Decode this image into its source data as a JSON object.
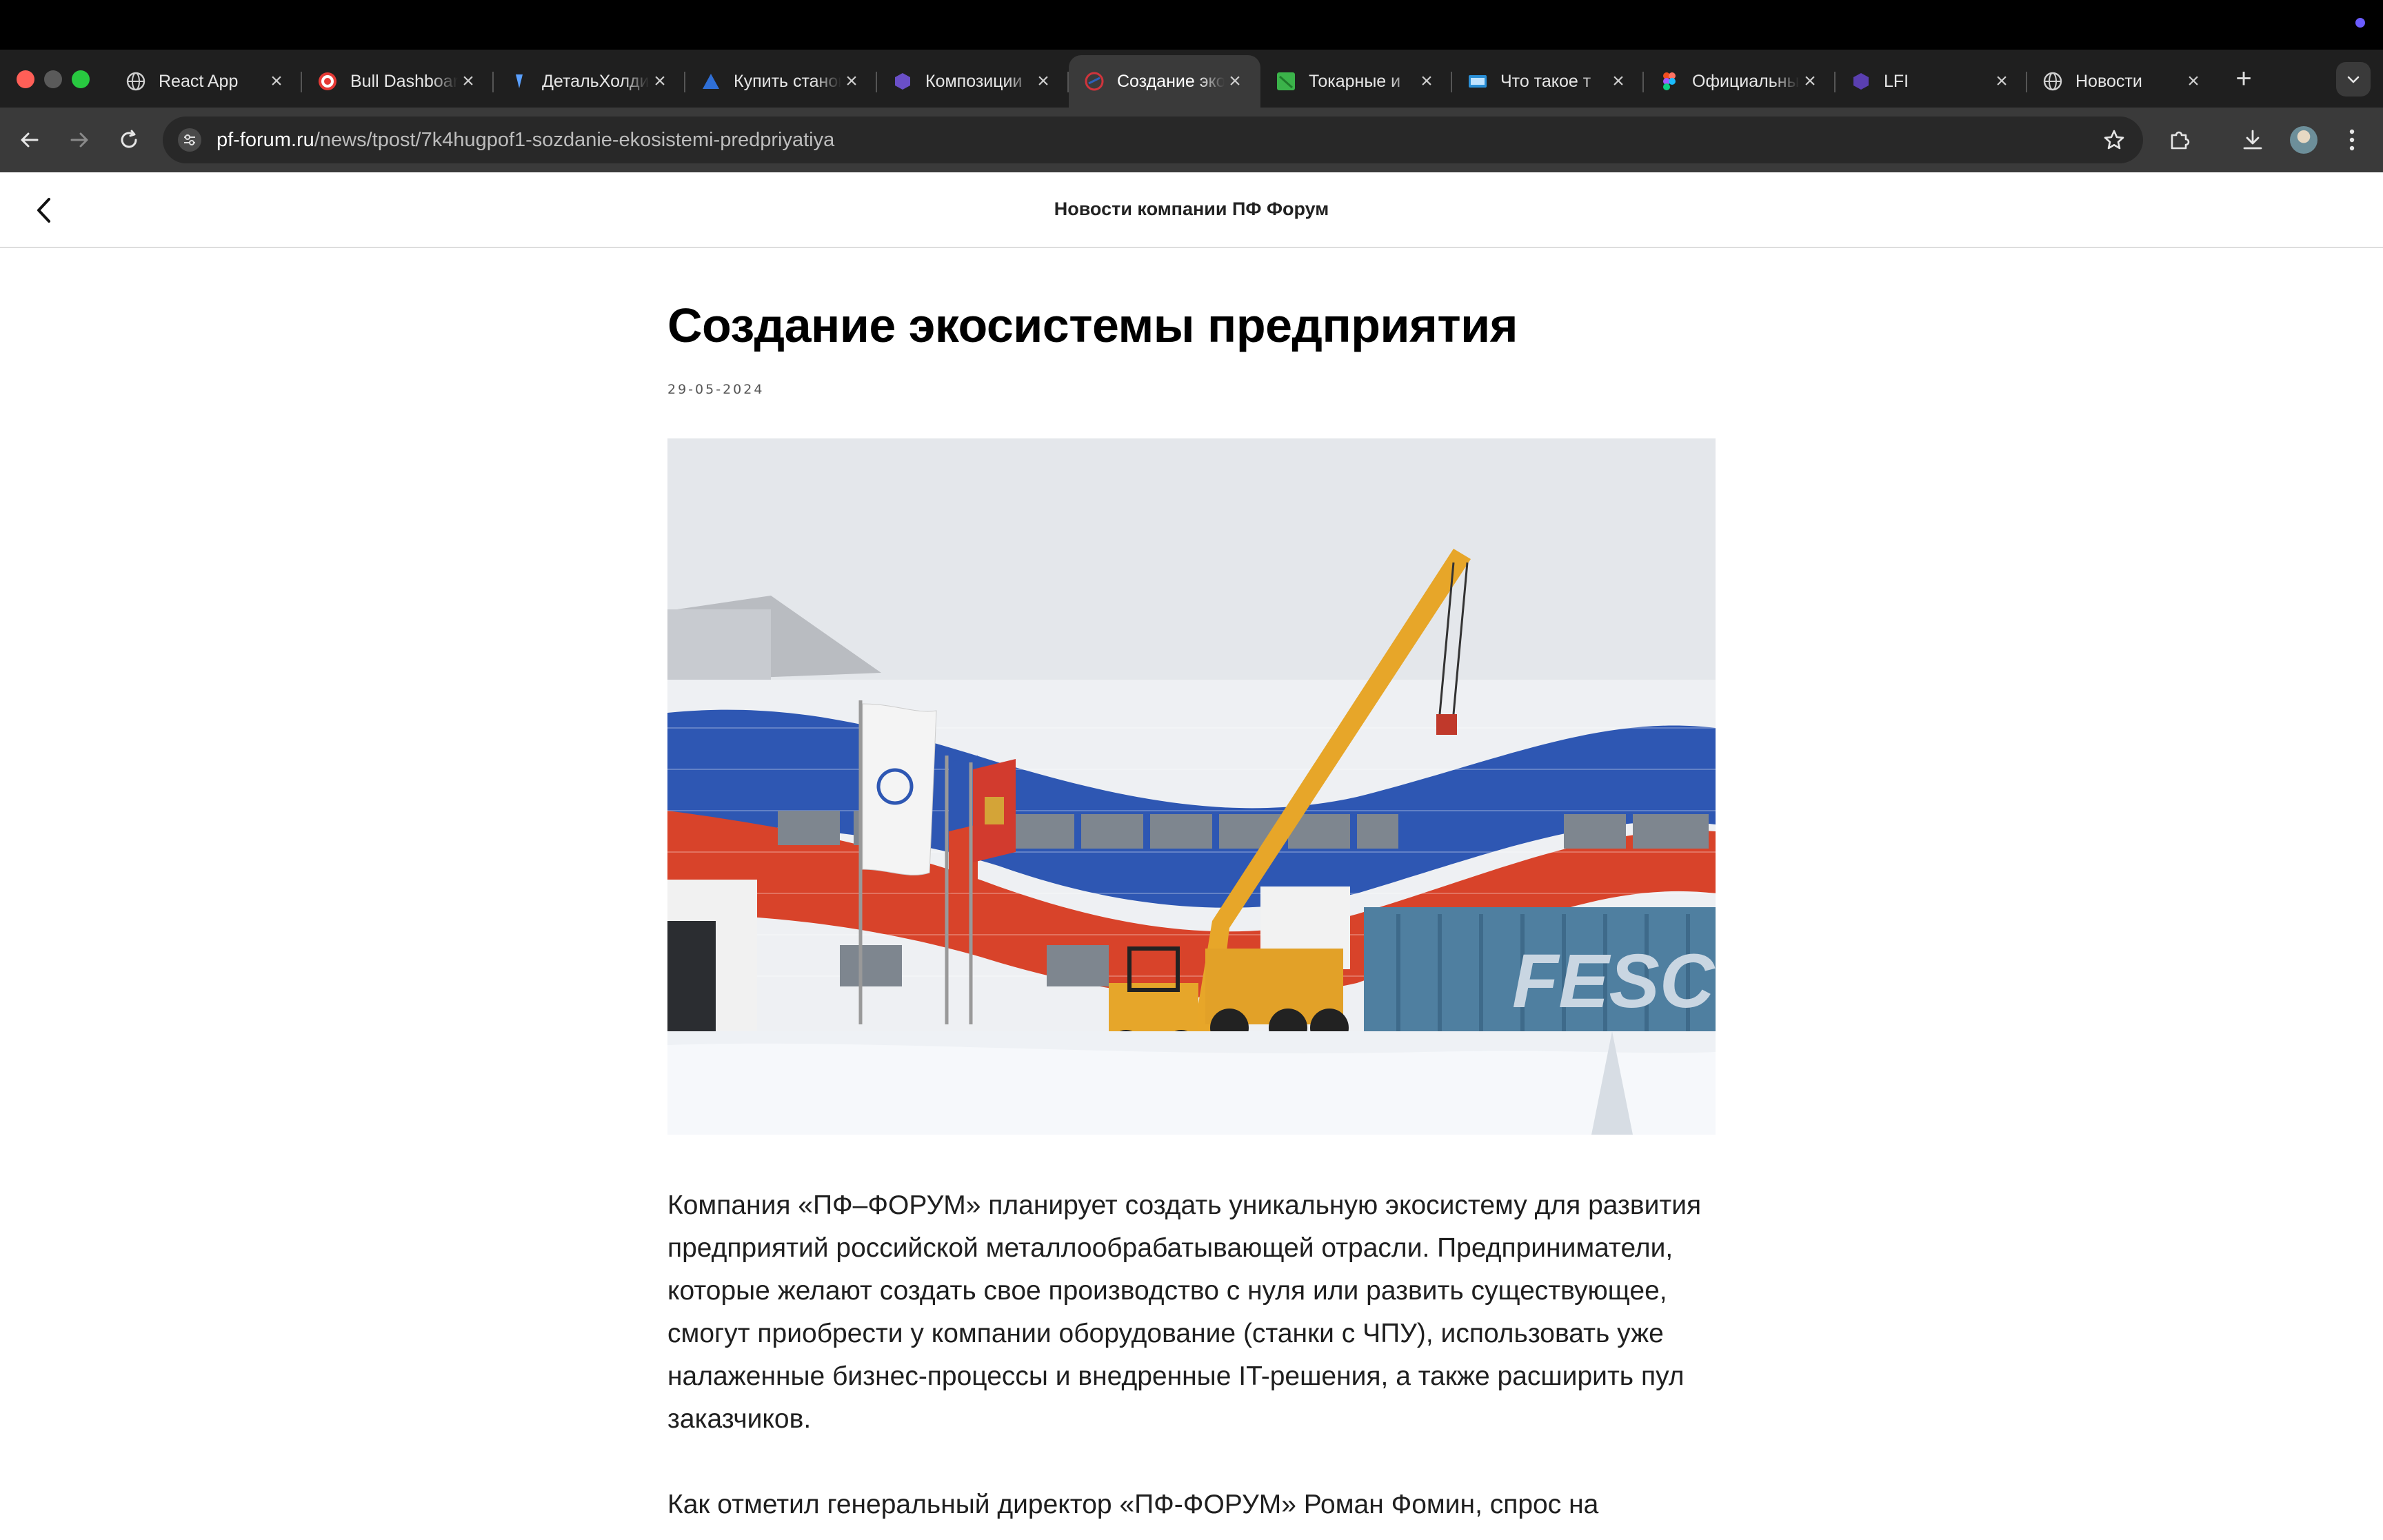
{
  "browser": {
    "tabs": [
      {
        "label": "React App",
        "icon": "globe-icon",
        "active": false
      },
      {
        "label": "Bull Dashboard",
        "icon": "target-icon",
        "active": false
      },
      {
        "label": "ДетальХолдинг",
        "icon": "detal-icon",
        "active": false
      },
      {
        "label": "Купить станок",
        "icon": "triangle-logo-icon",
        "active": false
      },
      {
        "label": "Композиции",
        "icon": "cube-icon",
        "active": false
      },
      {
        "label": "Создание экосистемы",
        "icon": "pf-forum-icon",
        "active": true
      },
      {
        "label": "Токарные и",
        "icon": "green-leaf-icon",
        "active": false
      },
      {
        "label": "Что такое т",
        "icon": "card-icon",
        "active": false
      },
      {
        "label": "Официальный",
        "icon": "figma-icon",
        "active": false
      },
      {
        "label": "LFI",
        "icon": "cube-icon",
        "active": false
      },
      {
        "label": "Новости",
        "icon": "globe-icon",
        "active": false
      }
    ],
    "url_host": "pf-forum.ru",
    "url_path": "/news/tpost/7k4hugpof1-sozdanie-ekosistemi-predpriyatiya"
  },
  "page": {
    "header_title": "Новости компании ПФ Форум",
    "article_title": "Создание экосистемы предприятия",
    "date": "29-05-2024",
    "hero_image_text": "FESC",
    "paragraph_1": "Компания «ПФ–ФОРУМ» планирует создать уникальную экосистему для развития предприятий российской металлообрабатывающей отрасли. Предприниматели, которые желают создать свое производство с нуля или развить существующее, смогут приобрести у компании оборудование (станки с ЧПУ), использовать уже налаженные бизнес-процессы и внедренные IT-решения, а также расширить пул заказчиков.",
    "paragraph_2": "Как отметил генеральный директор «ПФ-ФОРУМ» Роман Фомин, спрос на"
  },
  "colors": {
    "tab_strip": "#1f1f1f",
    "toolbar": "#3a3a3a",
    "omnibox": "#282828",
    "accent_dot": "#6b5cff"
  }
}
